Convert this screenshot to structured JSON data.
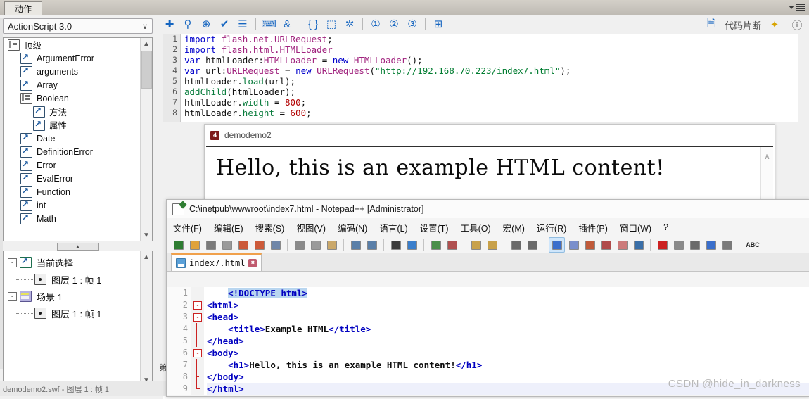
{
  "flash": {
    "panel_tab": "动作",
    "panel_menu_icon": "panel-menu-icon",
    "version_combo": {
      "value": "ActionScript 3.0",
      "chevron": "∨"
    },
    "toolbar_left": [
      {
        "name": "add-item-icon",
        "glyph": "✚"
      },
      {
        "name": "find-replace-icon",
        "glyph": "⚲"
      },
      {
        "name": "target-icon",
        "glyph": "⊕"
      },
      {
        "name": "check-syntax-icon",
        "glyph": "✔"
      },
      {
        "name": "auto-format-icon",
        "glyph": "☰"
      },
      {
        "name": "show-code-hint-icon",
        "glyph": "⌨"
      },
      {
        "name": "debug-options-icon",
        "glyph": "&"
      },
      {
        "name": "collapse-braces-icon",
        "glyph": "{ }"
      },
      {
        "name": "collapse-selection-icon",
        "glyph": "⬚"
      },
      {
        "name": "expand-all-icon",
        "glyph": "✲"
      },
      {
        "name": "apply-block-comment-icon",
        "glyph": "①"
      },
      {
        "name": "apply-line-comment-icon",
        "glyph": "②"
      },
      {
        "name": "remove-comment-icon",
        "glyph": "③"
      },
      {
        "name": "show-hide-toolbox-icon",
        "glyph": "⊞"
      }
    ],
    "toolbar_right": {
      "snippet_icon": "code-snippet-icon",
      "snippet_label": "代码片断",
      "wand_icon": "magic-wand-icon",
      "help_icon": "help-icon"
    },
    "tree": {
      "items": [
        {
          "label": "顶级",
          "icon": "package-icon",
          "indent": 0,
          "type": "pkg"
        },
        {
          "label": "ArgumentError",
          "icon": "class-icon",
          "indent": 1,
          "type": "arw"
        },
        {
          "label": "arguments",
          "icon": "class-icon",
          "indent": 1,
          "type": "arw"
        },
        {
          "label": "Array",
          "icon": "class-icon",
          "indent": 1,
          "type": "arw"
        },
        {
          "label": "Boolean",
          "icon": "package-icon",
          "indent": 1,
          "type": "pkg"
        },
        {
          "label": "方法",
          "icon": "class-icon",
          "indent": 2,
          "type": "arw"
        },
        {
          "label": "属性",
          "icon": "class-icon",
          "indent": 2,
          "type": "arw"
        },
        {
          "label": "Date",
          "icon": "class-icon",
          "indent": 1,
          "type": "arw"
        },
        {
          "label": "DefinitionError",
          "icon": "class-icon",
          "indent": 1,
          "type": "arw"
        },
        {
          "label": "Error",
          "icon": "class-icon",
          "indent": 1,
          "type": "arw"
        },
        {
          "label": "EvalError",
          "icon": "class-icon",
          "indent": 1,
          "type": "arw"
        },
        {
          "label": "Function",
          "icon": "class-icon",
          "indent": 1,
          "type": "arw"
        },
        {
          "label": "int",
          "icon": "class-icon",
          "indent": 1,
          "type": "arw"
        },
        {
          "label": "Math",
          "icon": "class-icon",
          "indent": 1,
          "type": "arw"
        }
      ]
    },
    "script_nav": {
      "groups": [
        {
          "label": "当前选择",
          "icon": "current-selection-icon",
          "expander": "-",
          "children": [
            {
              "label": "图层 1 : 帧 1",
              "icon": "frame-icon"
            }
          ]
        },
        {
          "label": "场景 1",
          "icon": "scene-icon",
          "expander": "-",
          "children": [
            {
              "label": "图层 1 : 帧 1",
              "icon": "frame-icon"
            }
          ]
        }
      ]
    },
    "code": {
      "lines": [
        {
          "n": "1",
          "tokens": [
            {
              "t": "import ",
              "c": "kw"
            },
            {
              "t": "flash.net.URLRequest",
              "c": "cls"
            },
            {
              "t": ";",
              "c": "pl"
            }
          ]
        },
        {
          "n": "2",
          "tokens": [
            {
              "t": "import ",
              "c": "kw"
            },
            {
              "t": "flash.html.HTMLLoader",
              "c": "cls"
            }
          ]
        },
        {
          "n": "3",
          "tokens": [
            {
              "t": "var ",
              "c": "kw"
            },
            {
              "t": "htmlLoader:",
              "c": "pl"
            },
            {
              "t": "HTMLLoader",
              "c": "cls"
            },
            {
              "t": " = ",
              "c": "pl"
            },
            {
              "t": "new ",
              "c": "kw"
            },
            {
              "t": "HTMLLoader",
              "c": "cls"
            },
            {
              "t": "();",
              "c": "pl"
            }
          ]
        },
        {
          "n": "4",
          "tokens": [
            {
              "t": "var ",
              "c": "kw"
            },
            {
              "t": "url:",
              "c": "pl"
            },
            {
              "t": "URLRequest",
              "c": "cls"
            },
            {
              "t": " = ",
              "c": "pl"
            },
            {
              "t": "new ",
              "c": "kw"
            },
            {
              "t": "URLRequest",
              "c": "cls"
            },
            {
              "t": "(",
              "c": "pl"
            },
            {
              "t": "\"http://192.168.70.223/index7.html\"",
              "c": "str"
            },
            {
              "t": ");",
              "c": "pl"
            }
          ]
        },
        {
          "n": "5",
          "tokens": [
            {
              "t": "htmlLoader.",
              "c": "pl"
            },
            {
              "t": "load",
              "c": "fn"
            },
            {
              "t": "(url);",
              "c": "pl"
            }
          ]
        },
        {
          "n": "6",
          "tokens": [
            {
              "t": "addChild",
              "c": "fn"
            },
            {
              "t": "(htmlLoader);",
              "c": "pl"
            }
          ]
        },
        {
          "n": "7",
          "tokens": [
            {
              "t": "htmlLoader.",
              "c": "pl"
            },
            {
              "t": "width",
              "c": "prop"
            },
            {
              "t": " = ",
              "c": "pl"
            },
            {
              "t": "800",
              "c": "num"
            },
            {
              "t": ";",
              "c": "pl"
            }
          ]
        },
        {
          "n": "8",
          "tokens": [
            {
              "t": "htmlLoader.",
              "c": "pl"
            },
            {
              "t": "height",
              "c": "prop"
            },
            {
              "t": " = ",
              "c": "pl"
            },
            {
              "t": "600",
              "c": "num"
            },
            {
              "t": ";",
              "c": "pl"
            }
          ]
        }
      ]
    },
    "status_text": "demodemo2.swf - 图层 1 : 帧 1",
    "vertical_label": "第"
  },
  "demo_window": {
    "badge": "4",
    "title": "demodemo2",
    "heading": "Hello, this is an example HTML content!",
    "scroll_arrow": "∧"
  },
  "notepad": {
    "title": "C:\\inetpub\\wwwroot\\index7.html - Notepad++ [Administrator]",
    "title_icon": "notepad-plus-plus-icon",
    "menu": [
      "文件(F)",
      "编辑(E)",
      "搜索(S)",
      "视图(V)",
      "编码(N)",
      "语言(L)",
      "设置(T)",
      "工具(O)",
      "宏(M)",
      "运行(R)",
      "插件(P)",
      "窗口(W)",
      "?"
    ],
    "toolbar": [
      {
        "name": "new-file-icon",
        "glyph": "□"
      },
      {
        "name": "open-file-icon",
        "glyph": "□"
      },
      {
        "name": "save-icon",
        "glyph": "□"
      },
      {
        "name": "save-all-icon",
        "glyph": "□"
      },
      {
        "name": "close-file-icon",
        "glyph": "□"
      },
      {
        "name": "close-all-icon",
        "glyph": "□"
      },
      {
        "name": "print-icon",
        "glyph": "□"
      },
      {
        "name": "sep",
        "glyph": ""
      },
      {
        "name": "cut-icon",
        "glyph": "✂"
      },
      {
        "name": "copy-icon",
        "glyph": "□"
      },
      {
        "name": "paste-icon",
        "glyph": "□"
      },
      {
        "name": "sep",
        "glyph": ""
      },
      {
        "name": "undo-icon",
        "glyph": "↶"
      },
      {
        "name": "redo-icon",
        "glyph": "↷"
      },
      {
        "name": "sep",
        "glyph": ""
      },
      {
        "name": "find-icon",
        "glyph": "⚲"
      },
      {
        "name": "replace-icon",
        "glyph": "□"
      },
      {
        "name": "sep",
        "glyph": ""
      },
      {
        "name": "zoom-in-icon",
        "glyph": "⊕"
      },
      {
        "name": "zoom-out-icon",
        "glyph": "⊖"
      },
      {
        "name": "sep",
        "glyph": ""
      },
      {
        "name": "sync-vertical-scroll-icon",
        "glyph": "□"
      },
      {
        "name": "sync-horizontal-scroll-icon",
        "glyph": "□"
      },
      {
        "name": "sep",
        "glyph": ""
      },
      {
        "name": "word-wrap-icon",
        "glyph": "≡"
      },
      {
        "name": "show-all-characters-icon",
        "glyph": "¶"
      },
      {
        "name": "sep",
        "glyph": ""
      },
      {
        "name": "indent-guide-icon",
        "glyph": "≣"
      },
      {
        "name": "user-defined-language-icon",
        "glyph": "□"
      },
      {
        "name": "show-document-map-icon",
        "glyph": "□"
      },
      {
        "name": "function-list-icon",
        "glyph": "□"
      },
      {
        "name": "folder-as-workspace-icon",
        "glyph": "□"
      },
      {
        "name": "monitoring-icon",
        "glyph": "◉"
      },
      {
        "name": "sep",
        "glyph": ""
      },
      {
        "name": "start-record-macro-icon",
        "glyph": "●"
      },
      {
        "name": "stop-record-macro-icon",
        "glyph": "■"
      },
      {
        "name": "playback-macro-icon",
        "glyph": "▶"
      },
      {
        "name": "run-macro-multiple-icon",
        "glyph": "▶▶"
      },
      {
        "name": "save-macro-icon",
        "glyph": "▤"
      },
      {
        "name": "sep",
        "glyph": ""
      },
      {
        "name": "spell-check-icon",
        "glyph": "ABC"
      }
    ],
    "tab": {
      "label": "index7.html",
      "save_icon": "floppy-icon",
      "close": "✖"
    },
    "code": {
      "lines": [
        {
          "n": "1",
          "fold": "none",
          "current": false,
          "tokens": [
            {
              "t": "    ",
              "c": "pl"
            },
            {
              "t": "<!DOCTYPE html>",
              "c": "tag sel"
            }
          ]
        },
        {
          "n": "2",
          "fold": "open",
          "current": false,
          "tokens": [
            {
              "t": "<html>",
              "c": "tag"
            }
          ]
        },
        {
          "n": "3",
          "fold": "open",
          "current": false,
          "tokens": [
            {
              "t": "<head>",
              "c": "tag"
            }
          ]
        },
        {
          "n": "4",
          "fold": "line",
          "current": false,
          "tokens": [
            {
              "t": "    ",
              "c": "pl"
            },
            {
              "t": "<title>",
              "c": "tag"
            },
            {
              "t": "Example HTML",
              "c": "txt"
            },
            {
              "t": "</title>",
              "c": "tag"
            }
          ]
        },
        {
          "n": "5",
          "fold": "mid",
          "current": false,
          "tokens": [
            {
              "t": "</head>",
              "c": "tag"
            }
          ]
        },
        {
          "n": "6",
          "fold": "open",
          "current": false,
          "tokens": [
            {
              "t": "<body>",
              "c": "tag"
            }
          ]
        },
        {
          "n": "7",
          "fold": "line",
          "current": false,
          "tokens": [
            {
              "t": "    ",
              "c": "pl"
            },
            {
              "t": "<h1>",
              "c": "tag"
            },
            {
              "t": "Hello, this is an example HTML content!",
              "c": "txt"
            },
            {
              "t": "</h1>",
              "c": "tag"
            }
          ]
        },
        {
          "n": "8",
          "fold": "mid",
          "current": false,
          "tokens": [
            {
              "t": "</body>",
              "c": "tag"
            }
          ]
        },
        {
          "n": "9",
          "fold": "end",
          "current": true,
          "tokens": [
            {
              "t": "</html>",
              "c": "tag"
            }
          ]
        }
      ]
    }
  },
  "watermark": "CSDN @hide_in_darkness"
}
